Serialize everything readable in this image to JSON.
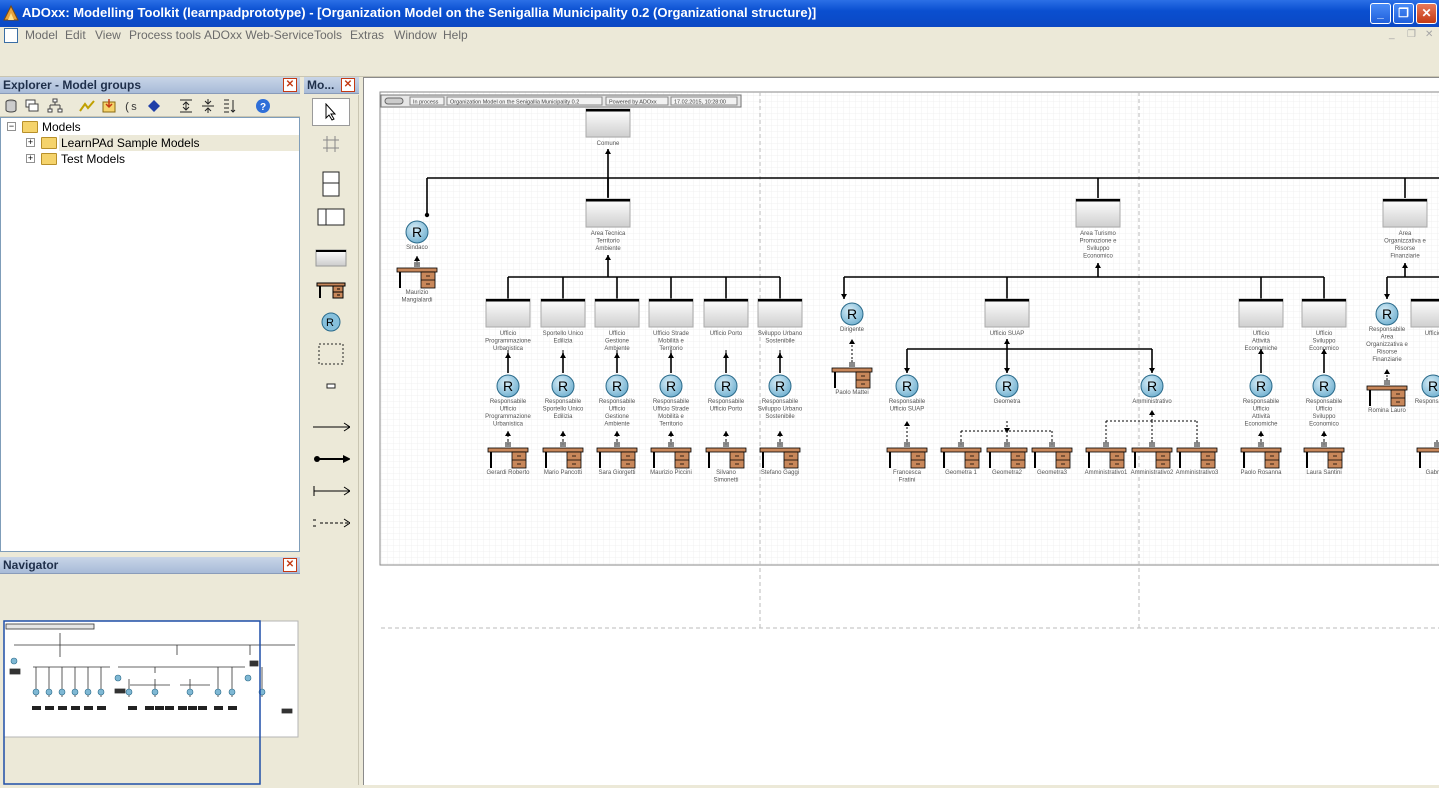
{
  "window": {
    "title": "ADOxx: Modelling Toolkit (learnpadprototype) - [Organization Model on the Senigallia Municipality 0.2 (Organizational structure)]",
    "minimize_glyph": "_",
    "restore_glyph": "❐",
    "close_glyph": "✕"
  },
  "menubar": {
    "items": [
      "Model",
      "Edit",
      "View",
      "Process tools",
      "ADOxx Web-Service",
      "Tools",
      "Extras",
      "Window",
      "Help"
    ],
    "mdi_controls": [
      "_",
      "❐",
      "✕"
    ]
  },
  "explorer": {
    "title": "Explorer - Model groups",
    "close_glyph": "✕",
    "tree": {
      "root": "Models",
      "children": [
        "LearnPAd Sample Models",
        "Test Models"
      ]
    }
  },
  "modelling_bar": {
    "title": "Mo...",
    "close_glyph": "✕"
  },
  "navigator": {
    "title": "Navigator",
    "close_glyph": "✕"
  },
  "canvas": {
    "header_cells": [
      "In process",
      "Organization Model on the Senigallia Municipality 0.2",
      "Powered by ADOxx",
      "17.02.2015, 10:28:00"
    ],
    "top_unit": "Comune",
    "mayor": {
      "role": "Sindaco",
      "performer": "Maurizio Mangialardi"
    },
    "area_units": [
      "Area Tecnica Territorio Ambiente",
      "Area Turismo Promozione e Sviluppo Economico",
      "Area Organizzativa e Risorse Finanziarie"
    ],
    "tech_units": [
      {
        "unit": "Ufficio Programmazione Urbanistica",
        "role": "Responsabile Ufficio Programmazione Urbanistica",
        "performer": "Gerardi Roberto"
      },
      {
        "unit": "Sportello Unico Edilizia",
        "role": "Responsabile Sportello Unico Edilizia",
        "performer": "Mario Pancotti"
      },
      {
        "unit": "Ufficio Gestione Ambiente",
        "role": "Responsabile Ufficio Gestione Ambiente",
        "performer": "Sara Giorgetti"
      },
      {
        "unit": "Ufficio Strade Mobilità e Territorio",
        "role": "Responsabile Ufficio Strade Mobilità e Territorio",
        "performer": "Maurizio Piccini"
      },
      {
        "unit": "Ufficio Porto",
        "role": "Responsabile Ufficio Porto",
        "performer": "Silvano Simonetti"
      },
      {
        "unit": "Sviluppo Urbano Sostenibile",
        "role": "Responsabile Sviluppo Urbano Sostenibile",
        "performer": "Stefano Gaggi"
      }
    ],
    "dirigente": {
      "role": "Dirigente",
      "performer": "Paolo Mattei"
    },
    "suap": {
      "unit": "Ufficio SUAP",
      "responsible": {
        "role": "Responsabile Ufficio SUAP",
        "performer": "Francesca Fratini"
      },
      "geometra_role": "Geometra",
      "geometra_performers": [
        "Geometra 1",
        "Geometra2",
        "Geometra3"
      ],
      "admin_role": "Amministrativo",
      "admin_performers": [
        "Amministrativo1",
        "Amministrativo2",
        "Amministrativo3"
      ]
    },
    "econ_units": [
      {
        "unit": "Ufficio Attività Economiche",
        "role": "Responsabile Ufficio Attività Economiche",
        "performer": "Paolo Rosanna"
      },
      {
        "unit": "Ufficio Sviluppo Economico",
        "role": "Responsabile Ufficio Sviluppo Economico",
        "performer": "Laura Santini"
      }
    ],
    "org_area": {
      "role": "Responsabile Area Organizzativa e Risorse Finanziarie",
      "performer": "Romina Lauro"
    },
    "partial_labels": [
      "Ufficio",
      "Responsabile",
      "Gabriele"
    ]
  }
}
